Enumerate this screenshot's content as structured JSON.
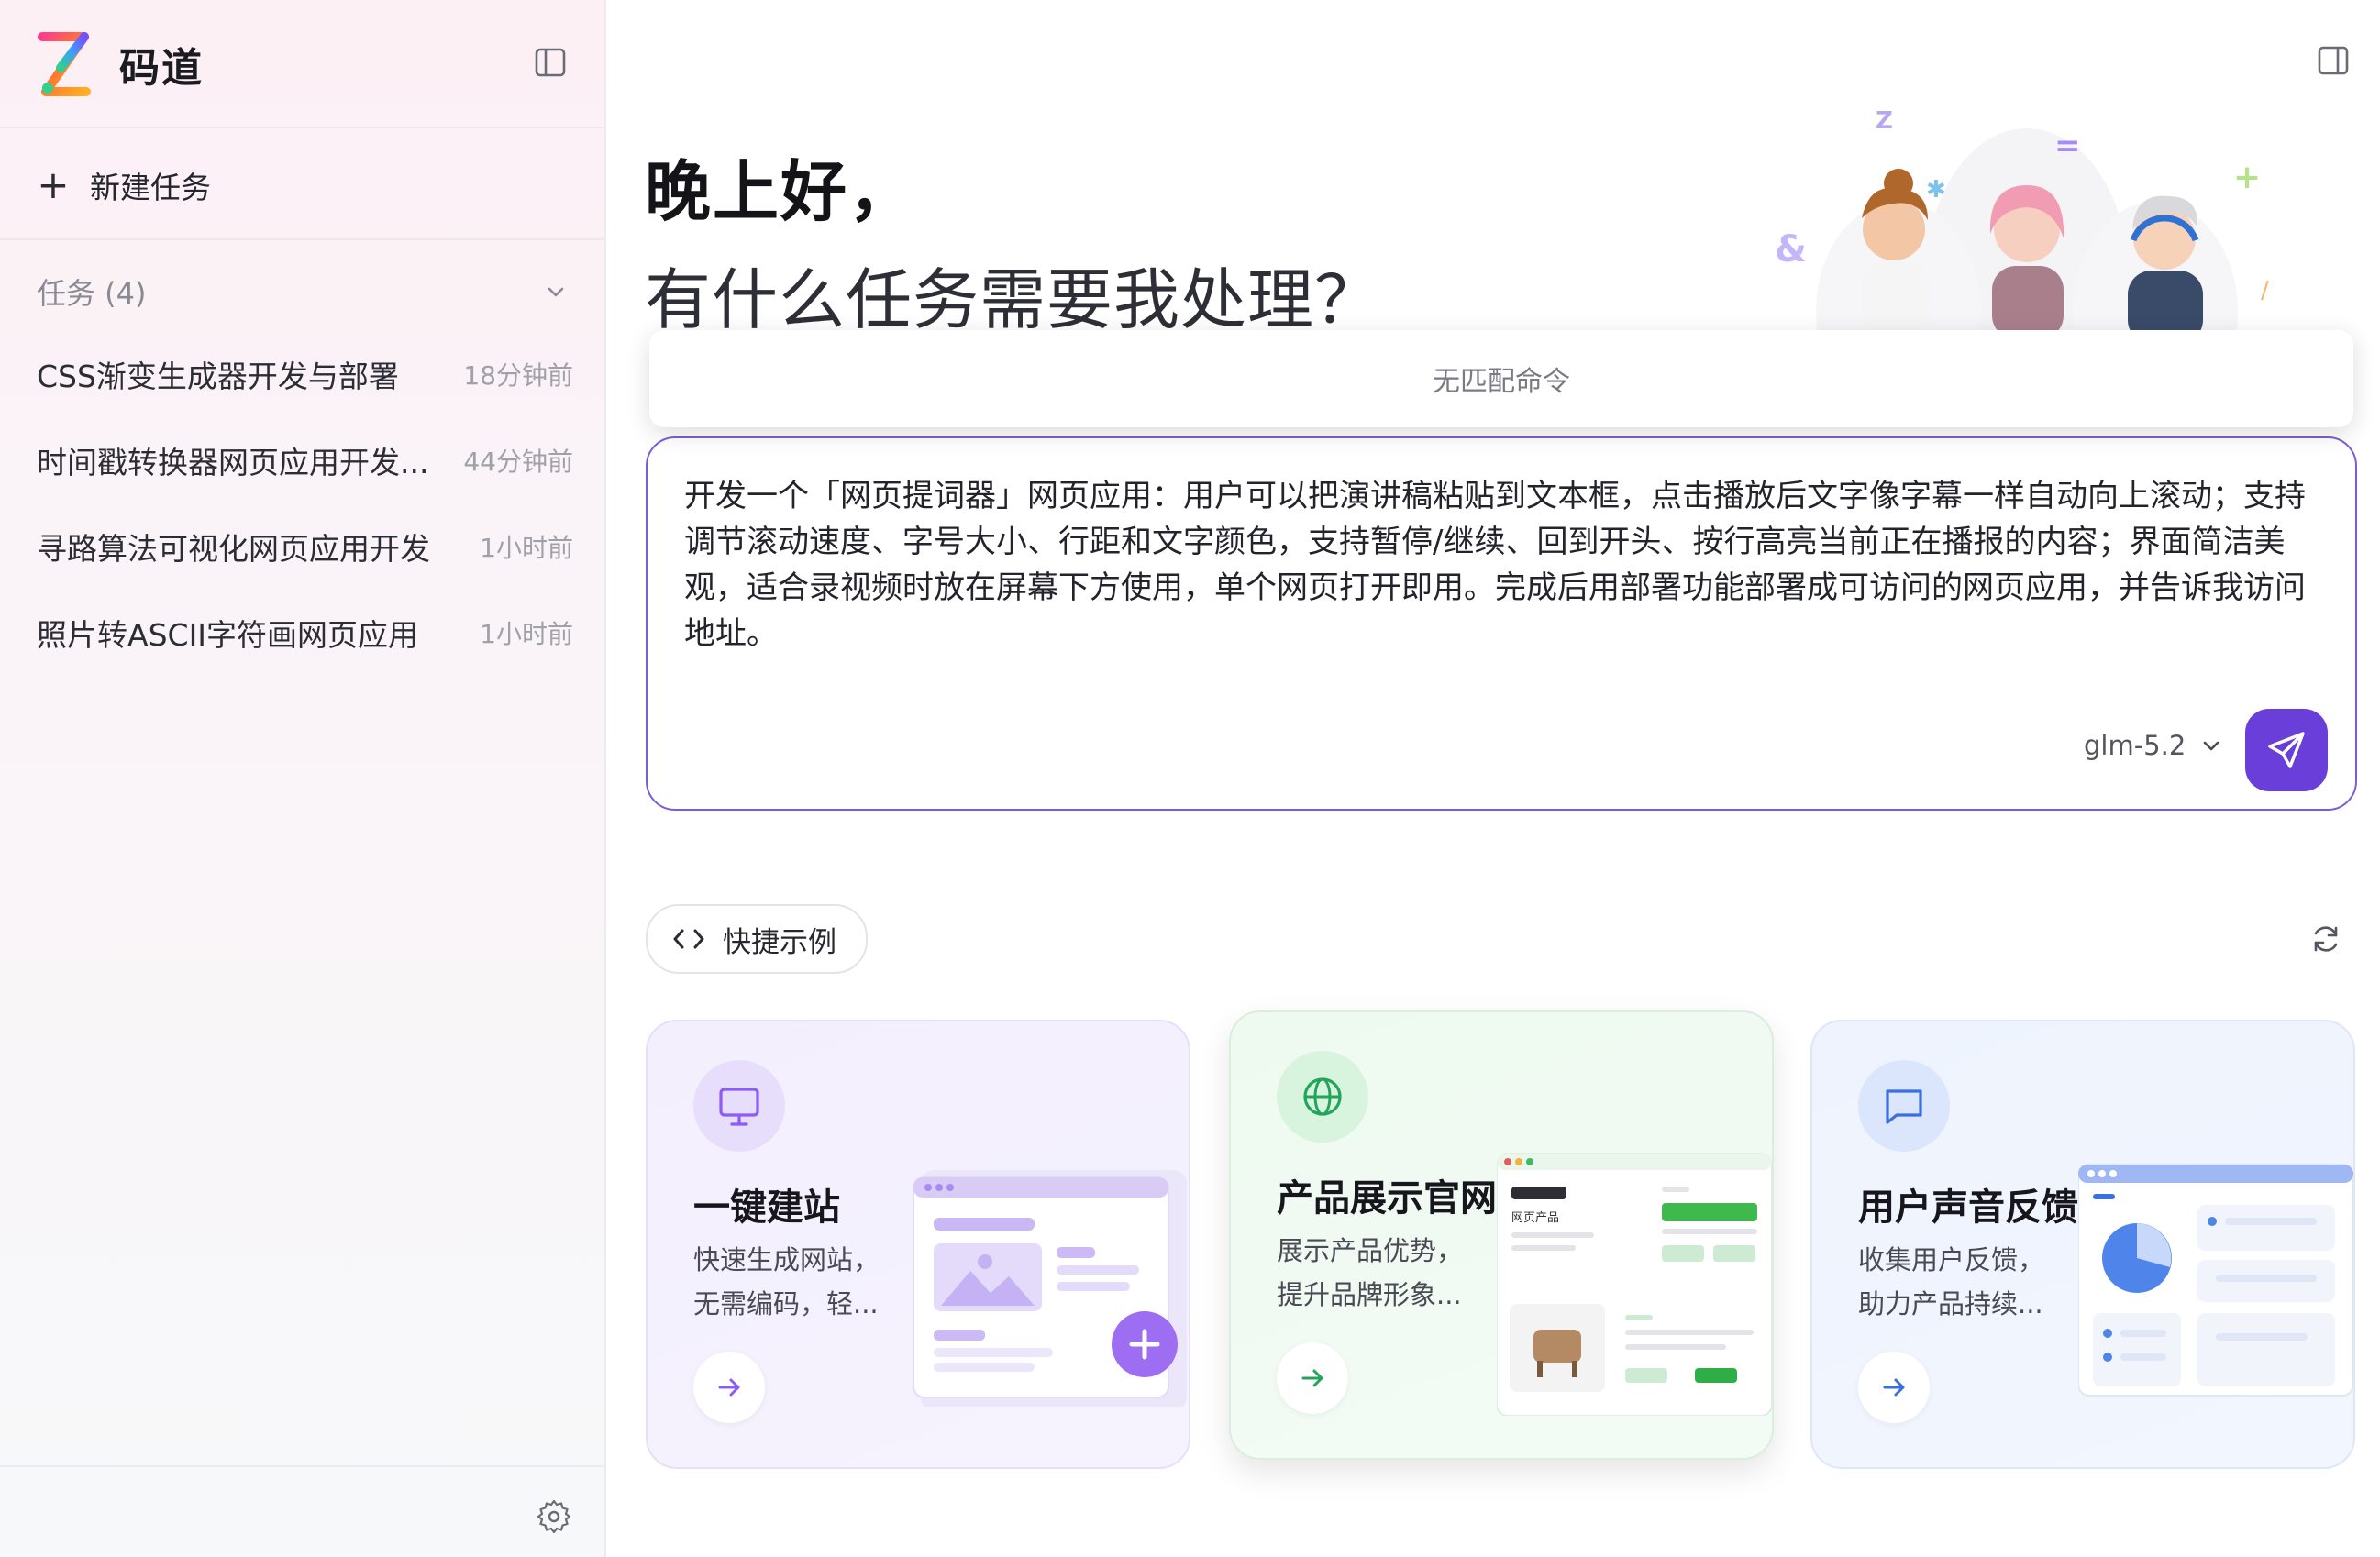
{
  "sidebar": {
    "brand": {
      "name": "码道",
      "logo_icon": "infinity-logo-icon"
    },
    "new_task_label": "新建任务",
    "tasks_header": "任务 (4)",
    "tasks": [
      {
        "name": "CSS渐变生成器开发与部署",
        "time": "18分钟前"
      },
      {
        "name": "时间戳转换器网页应用开发...",
        "time": "44分钟前"
      },
      {
        "name": "寻路算法可视化网页应用开发",
        "time": "1小时前"
      },
      {
        "name": "照片转ASCII字符画网页应用",
        "time": "1小时前"
      }
    ]
  },
  "main": {
    "greeting": "晚上好，",
    "question": "有什么任务需要我处理？",
    "command_dropdown": "无匹配命令",
    "prompt": "开发一个「网页提词器」网页应用：用户可以把演讲稿粘贴到文本框，点击播放后文字像字幕一样自动向上滚动；支持调节滚动速度、字号大小、行距和文字颜色，支持暂停/继续、回到开头、按行高亮当前正在播报的内容；界面简洁美观，适合录视频时放在屏幕下方使用，单个网页打开即用。完成后用部署功能部署成可访问的网页应用，并告诉我访问地址。",
    "model": "glm-5.2",
    "quick_examples_label": "快捷示例",
    "cards": [
      {
        "title": "一键建站",
        "desc1": "快速生成网站，",
        "desc2": "无需编码，轻...",
        "icon": "monitor-icon",
        "accent": "#8b5cf6"
      },
      {
        "title": "产品展示官网",
        "desc1": "展示产品优势，",
        "desc2": "提升品牌形象...",
        "icon": "globe-icon",
        "accent": "#22a55a"
      },
      {
        "title": "用户声音反馈",
        "desc1": "收集用户反馈，",
        "desc2": "助力产品持续...",
        "icon": "message-square-icon",
        "accent": "#3b6fe0"
      }
    ],
    "mock_product_title": "网页产品"
  },
  "colors": {
    "accent": "#6a3fd9",
    "border": "#7c5cd6"
  }
}
